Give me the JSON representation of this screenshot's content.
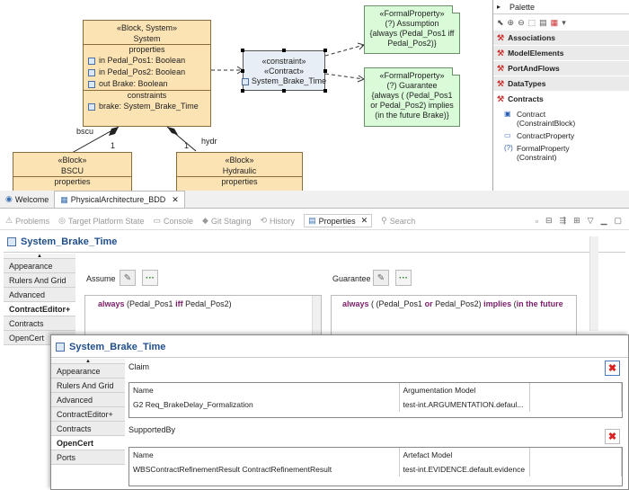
{
  "diagram": {
    "system_block": {
      "stereotype": "«Block, System»",
      "name": "System",
      "properties_label": "properties",
      "properties": [
        "in Pedal_Pos1: Boolean",
        "in Pedal_Pos2: Boolean",
        "out Brake: Boolean"
      ],
      "constraints_label": "constraints",
      "constraints": [
        "brake: System_Brake_Time"
      ]
    },
    "constraint_block": {
      "stereotype1": "«constraint»",
      "stereotype2": "«Contract»",
      "name": "System_Brake_Time"
    },
    "assumption_note": {
      "stereotype": "«FormalProperty»",
      "name": "(?) Assumption",
      "line1": "{always (Pedal_Pos1 iff",
      "line2": "Pedal_Pos2)}"
    },
    "guarantee_note": {
      "stereotype": "«FormalProperty»",
      "name": "(?) Guarantee",
      "line1": "{always ( (Pedal_Pos1",
      "line2": "or Pedal_Pos2) implies",
      "line3": "(in the future Brake)}"
    },
    "bscu_block": {
      "stereotype": "«Block»",
      "name": "BSCU",
      "properties_label": "properties"
    },
    "hydraulic_block": {
      "stereotype": "«Block»",
      "name": "Hydraulic",
      "properties_label": "properties"
    },
    "edge_bscu": {
      "role": "bscu",
      "mult": "1"
    },
    "edge_hydr": {
      "role": "hydr",
      "mult": "1"
    }
  },
  "palette": {
    "title": "Palette",
    "drawers": [
      "Associations",
      "ModelElements",
      "PortAndFlows",
      "DataTypes",
      "Contracts"
    ],
    "items": [
      {
        "label": "Contract",
        "sub": "(ConstraintBlock)",
        "icon": "contract-icon"
      },
      {
        "label": "ContractProperty",
        "sub": "",
        "icon": "contract-property-icon"
      },
      {
        "label": "FormalProperty",
        "sub": "(Constraint)",
        "icon": "formal-property-icon"
      }
    ]
  },
  "editor_tabs": [
    {
      "label": "Welcome",
      "active": false
    },
    {
      "label": "PhysicalArchitecture_BDD",
      "active": true
    }
  ],
  "view_tabs": [
    "Problems",
    "Target Platform State",
    "Console",
    "Git Staging",
    "History",
    "Properties",
    "Search"
  ],
  "active_view": "Properties",
  "back_properties": {
    "title": "System_Brake_Time",
    "side_tabs": [
      "Appearance",
      "Rulers And Grid",
      "Advanced",
      "ContractEditor+",
      "Contracts",
      "OpenCert"
    ],
    "selected_tab": "ContractEditor+",
    "assume_label": "Assume",
    "guarantee_label": "Guarantee",
    "assume_text": {
      "kw1": "always",
      "t1": " (Pedal_Pos1 ",
      "kw2": "iff",
      "t2": " Pedal_Pos2)"
    },
    "guarantee_text": {
      "kw1": "always",
      "t1": " ( (Pedal_Pos1 ",
      "kw2": "or",
      "t2": " Pedal_Pos2) ",
      "kw3": "implies",
      "t3": " (",
      "kw4": "in the future"
    }
  },
  "front_properties": {
    "title": "System_Brake_Time",
    "side_tabs": [
      "Appearance",
      "Rulers And Grid",
      "Advanced",
      "ContractEditor+",
      "Contracts",
      "OpenCert",
      "Ports"
    ],
    "selected_tab": "OpenCert",
    "claim": {
      "label": "Claim",
      "headers": [
        "Name",
        "Argumentation Model"
      ],
      "rows": [
        [
          "G2 Req_BrakeDelay_Formalization",
          "test-int.ARGUMENTATION.defaul..."
        ]
      ]
    },
    "supported_by": {
      "label": "SupportedBy",
      "headers": [
        "Name",
        "Artefact Model"
      ],
      "rows": [
        [
          "WBSContractRefinementResult ContractRefinementResult",
          "test-int.EVIDENCE.default.evidence"
        ]
      ]
    }
  }
}
